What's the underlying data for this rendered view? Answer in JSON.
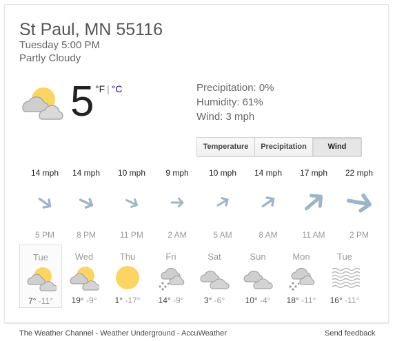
{
  "header": {
    "location": "St Paul, MN 55116",
    "daytime": "Tuesday 5:00 PM",
    "condition": "Partly Cloudy"
  },
  "current": {
    "temperature": "5",
    "unit_f": "°F",
    "unit_sep": "|",
    "unit_c": "°C",
    "icon": "partly-cloudy-icon",
    "precipitation": "Precipitation: 0%",
    "humidity": "Humidity: 61%",
    "wind": "Wind: 3 mph"
  },
  "tabs": [
    {
      "label": "Temperature",
      "active": false
    },
    {
      "label": "Precipitation",
      "active": false
    },
    {
      "label": "Wind",
      "active": true
    }
  ],
  "wind_forecast": [
    {
      "speed": "14 mph",
      "time": "5 PM"
    },
    {
      "speed": "14 mph",
      "time": "8 PM"
    },
    {
      "speed": "10 mph",
      "time": "11 PM"
    },
    {
      "speed": "9 mph",
      "time": "2 AM"
    },
    {
      "speed": "10 mph",
      "time": "5 AM"
    },
    {
      "speed": "14 mph",
      "time": "8 AM"
    },
    {
      "speed": "17 mph",
      "time": "11 AM"
    },
    {
      "speed": "22 mph",
      "time": "2 PM"
    }
  ],
  "daily_forecast": [
    {
      "day": "Tue",
      "icon": "partly-cloudy-icon",
      "hi": "7°",
      "lo": "-11°",
      "selected": true
    },
    {
      "day": "Wed",
      "icon": "partly-cloudy-icon",
      "hi": "19°",
      "lo": "-9°",
      "selected": false
    },
    {
      "day": "Thu",
      "icon": "sunny-icon",
      "hi": "1°",
      "lo": "-17°",
      "selected": false
    },
    {
      "day": "Fri",
      "icon": "snow-showers-icon",
      "hi": "14°",
      "lo": "-9°",
      "selected": false
    },
    {
      "day": "Sat",
      "icon": "cloudy-icon",
      "hi": "3°",
      "lo": "-6°",
      "selected": false
    },
    {
      "day": "Sun",
      "icon": "cloudy-icon",
      "hi": "10°",
      "lo": "-4°",
      "selected": false
    },
    {
      "day": "Mon",
      "icon": "snow-showers-icon",
      "hi": "18°",
      "lo": "-11°",
      "selected": false
    },
    {
      "day": "Tue",
      "icon": "fog-icon",
      "hi": "16°",
      "lo": "-11°",
      "selected": false
    }
  ],
  "footer": {
    "source_1": "The Weather Channel",
    "source_2": "Weather Underground",
    "source_3": "AccuWeather",
    "separator": " - ",
    "feedback": "Send feedback"
  },
  "colors": {
    "sun": "#fcd462",
    "cloud": "#c8c8c8",
    "arrow": "#9db5c8",
    "link": "#1a0dab"
  }
}
